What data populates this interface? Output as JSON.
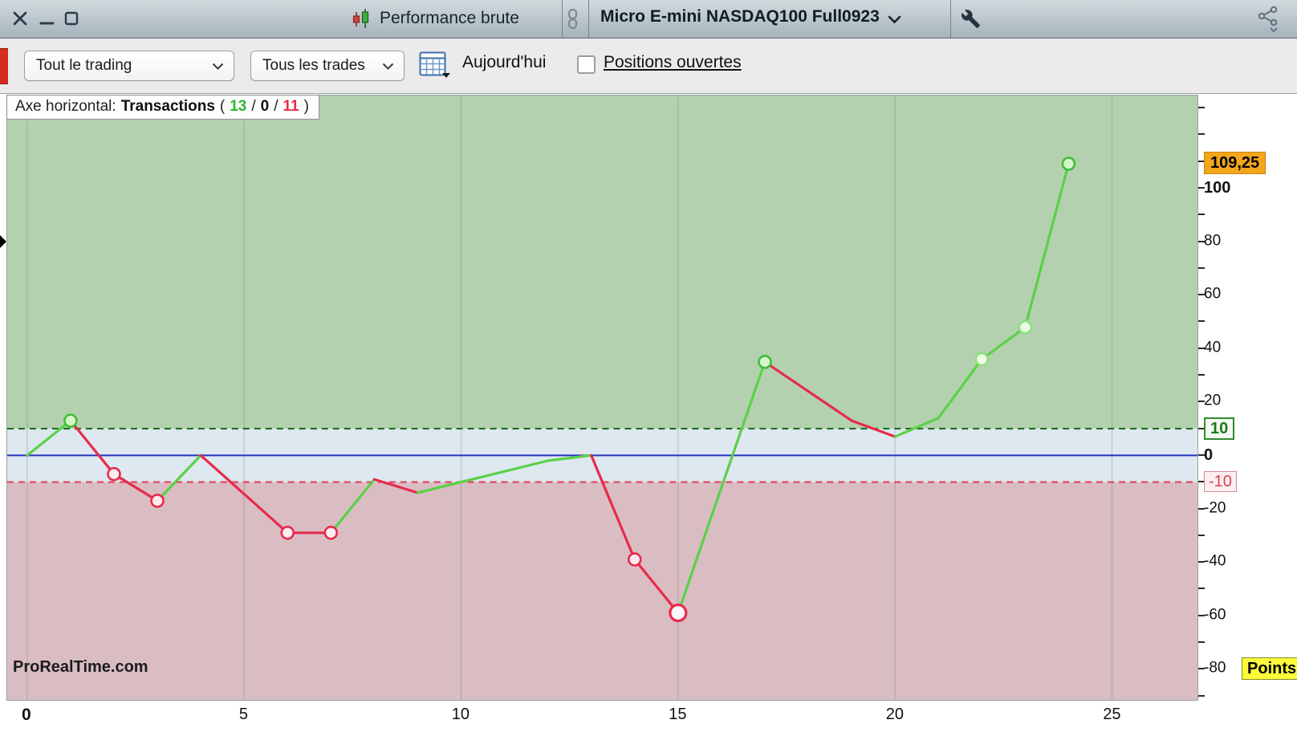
{
  "titlebar": {
    "title": "Performance brute",
    "instrument": "Micro E-mini NASDAQ100 Full0923"
  },
  "toolbar": {
    "scope_dropdown": "Tout le trading",
    "trades_dropdown": "Tous les trades",
    "date_label": "Aujourd'hui",
    "positions_label": "Positions ouvertes",
    "positions_checked": false
  },
  "chart_header": {
    "prefix": "Axe horizontal:",
    "axis_name": "Transactions",
    "open": "(",
    "wins": "13",
    "sep1": "/",
    "neutral": "0",
    "sep2": "/",
    "losses": "11",
    "close": ")"
  },
  "watermark": "ProRealTime.com",
  "icons": {
    "close-icon": "×",
    "minimize-icon": "−",
    "maximize-icon": "□",
    "candlestick-chart-icon": "▯▮",
    "link-chain-icon": "🔗",
    "chevron-down-icon": "⌄",
    "wrench-icon": "🔧",
    "share-icon": "<°",
    "calendar-icon": "▦",
    "checkbox-unchecked-icon": "☐"
  },
  "colors": {
    "wins_green": "#2eb82e",
    "losses_red": "#e8294a",
    "current_value_orange": "#f3a61c",
    "points_badge_yellow": "#fbfb3a"
  },
  "chart_data": {
    "type": "line",
    "title": "Performance brute - cumulative points per transaction",
    "xlabel": "Transactions",
    "ylabel": "Points",
    "x_range": [
      -0.46,
      26.97
    ],
    "y_range": [
      -91.6,
      134.8
    ],
    "x_ticks": [
      0,
      5,
      10,
      15,
      20,
      25
    ],
    "x_bold_tick": 0,
    "tick_step": 10,
    "grid_on": true,
    "grid_color": "rgba(80,100,80,0.25)",
    "up_color": "#5ad147",
    "down_color": "#e82a4c",
    "current_value": 109.25,
    "zones": [
      {
        "from": 10,
        "to": 134.8,
        "color": "#b4d1af"
      },
      {
        "from": -10,
        "to": 10,
        "color": "#dde8f0"
      },
      {
        "from": -91.6,
        "to": -10,
        "color": "#d9bdc3"
      }
    ],
    "reference_lines": [
      {
        "y": 10,
        "color": "#1e6e1e",
        "dash": true,
        "width": 2.2
      },
      {
        "y": 0,
        "color": "#2433c0",
        "dash": false,
        "width": 2
      },
      {
        "y": -10,
        "color": "#e24a5a",
        "dash": true,
        "width": 2.2
      }
    ],
    "marker_styles": {
      "green": {
        "r": 7.5,
        "fill": "#d6f5c9",
        "stroke": "#3dbe37",
        "sw": 2.6
      },
      "palegreen": {
        "r": 7.5,
        "fill": "#eefbe6",
        "stroke": "#8de17c",
        "sw": 2.6
      },
      "red": {
        "r": 7.5,
        "fill": "#fdecee",
        "stroke": "#e82a4c",
        "sw": 2.6
      },
      "red-big": {
        "r": 10,
        "fill": "#fdf5f6",
        "stroke": "#e82a4c",
        "sw": 3.2
      }
    },
    "points": [
      {
        "x": 0,
        "y": 0
      },
      {
        "x": 1,
        "y": 13,
        "marker": "green"
      },
      {
        "x": 2,
        "y": -7,
        "marker": "red"
      },
      {
        "x": 3,
        "y": -17,
        "marker": "red"
      },
      {
        "x": 4,
        "y": 0
      },
      {
        "x": 6,
        "y": -29,
        "marker": "red"
      },
      {
        "x": 7,
        "y": -29,
        "marker": "red"
      },
      {
        "x": 8,
        "y": -9
      },
      {
        "x": 9,
        "y": -14
      },
      {
        "x": 10,
        "y": -10
      },
      {
        "x": 11,
        "y": -6
      },
      {
        "x": 12,
        "y": -2
      },
      {
        "x": 13,
        "y": 0
      },
      {
        "x": 14,
        "y": -39,
        "marker": "red"
      },
      {
        "x": 15,
        "y": -59,
        "marker": "red-big"
      },
      {
        "x": 17,
        "y": 35,
        "marker": "green"
      },
      {
        "x": 18,
        "y": 24
      },
      {
        "x": 19,
        "y": 13
      },
      {
        "x": 20,
        "y": 7
      },
      {
        "x": 21,
        "y": 14
      },
      {
        "x": 22,
        "y": 36,
        "marker": "palegreen"
      },
      {
        "x": 23,
        "y": 48,
        "marker": "palegreen"
      },
      {
        "x": 24,
        "y": 109.25,
        "marker": "green"
      }
    ],
    "y_labels": [
      {
        "value": 109.25,
        "text": "109,25",
        "style": "orange"
      },
      {
        "value": 100,
        "text": "100",
        "style": "bold"
      },
      {
        "value": 80,
        "text": "80",
        "style": "plain"
      },
      {
        "value": 60,
        "text": "60",
        "style": "plain"
      },
      {
        "value": 40,
        "text": "40",
        "style": "plain"
      },
      {
        "value": 20,
        "text": "20",
        "style": "plain"
      },
      {
        "value": 10,
        "text": "10",
        "style": "green-box"
      },
      {
        "value": 0,
        "text": "0",
        "style": "bold"
      },
      {
        "value": -10,
        "text": "-10",
        "style": "red-box"
      },
      {
        "value": -20,
        "text": "-20",
        "style": "plain"
      },
      {
        "value": -40,
        "text": "-40",
        "style": "plain"
      },
      {
        "value": -60,
        "text": "-60",
        "style": "plain"
      },
      {
        "value": -80,
        "text": "-80",
        "style": "plain"
      }
    ],
    "unit_label": {
      "text": "Points",
      "style": "yellow",
      "value": -80
    }
  }
}
